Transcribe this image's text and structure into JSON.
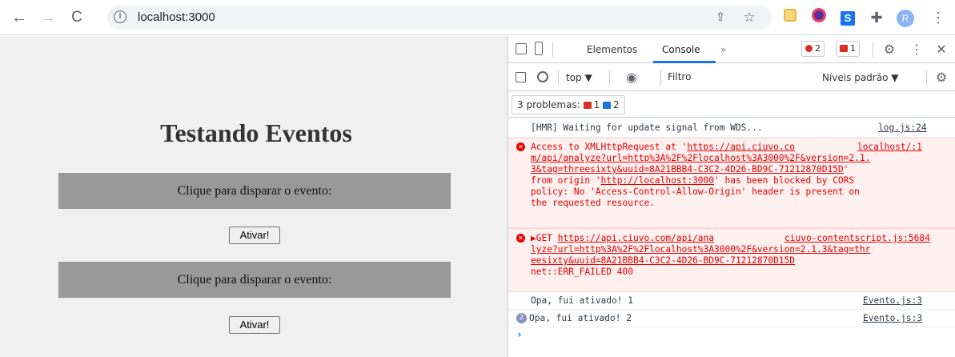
{
  "browser": {
    "url": "localhost:3000",
    "profile_initial": "R"
  },
  "page": {
    "title": "Testando Eventos",
    "events": [
      {
        "label": "Clique para disparar o evento:",
        "button": "Ativar!"
      },
      {
        "label": "Clique para disparar o evento:",
        "button": "Ativar!"
      }
    ]
  },
  "devtools": {
    "tabs": [
      "Elementos",
      "Console"
    ],
    "active_tab": "Console",
    "more": "»",
    "error_count": "2",
    "issue_count": "1",
    "context": "top ▼",
    "filter_placeholder": "Filtro",
    "levels": "Níveis padrão ▼",
    "problems_label": "3 problemas:",
    "problems_errors": "1",
    "problems_info": "2",
    "colors": {
      "accent": "#1a73e8",
      "error": "#e60000",
      "error_bg": "#fff0f0"
    }
  },
  "console": {
    "hmr": {
      "msg": "[HMR] Waiting for update signal from WDS...",
      "src": "log.js:24"
    },
    "cors": {
      "src": "localhost/:1",
      "l1a": "Access to XMLHttpRequest at '",
      "l1b": "https://api.ciuvo.co",
      "l2": "m/api/analyze?url=http%3A%2F%2Flocalhost%3A3000%2F&version=2.1.",
      "l3": "3&tag=threesixty&uuid=8A21BBB4-C3C2-4D26-BD9C-71212870D15D",
      "l3end": "'",
      "l4a": "from origin '",
      "l4b": "http://localhost:3000",
      "l4c": "' has been blocked by CORS",
      "l5": "policy: No 'Access-Control-Allow-Origin' header is present on",
      "l6": "the requested resource."
    },
    "get": {
      "src": "ciuvo-contentscript.js:5684",
      "l1a": "▶GET ",
      "l1b": "https://api.ciuvo.com/api/ana",
      "l2": "lyze?url=http%3A%2F%2Flocalhost%3A3000%2F&version=2.1.3&tag=thr",
      "l3": "eesixty&uuid=8A21BBB4-C3C2-4D26-BD9C-71212870D15D",
      "l4": "net::ERR_FAILED 400"
    },
    "log1": {
      "msg": "Opa, fui ativado! 1",
      "src": "Evento.js:3"
    },
    "log2": {
      "count": "2",
      "msg": "Opa, fui ativado! 2",
      "src": "Evento.js:3"
    }
  }
}
